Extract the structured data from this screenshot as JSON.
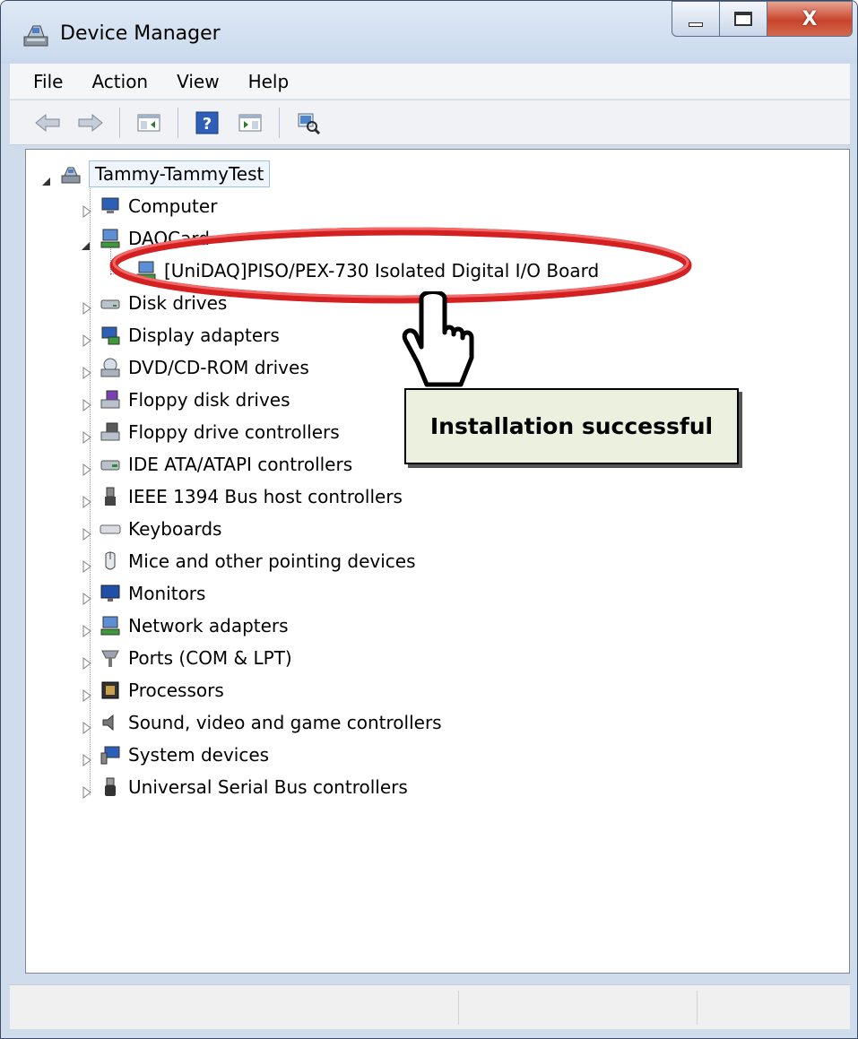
{
  "window": {
    "title": "Device Manager"
  },
  "menu": [
    "File",
    "Action",
    "View",
    "Help"
  ],
  "toolbar": {
    "icons": [
      "back-arrow-icon",
      "forward-arrow-icon",
      "show-hide-console-tree-icon",
      "help-icon",
      "properties-pane-icon",
      "scan-hardware-icon"
    ]
  },
  "tree": {
    "root": "Tammy-TammyTest",
    "categories": [
      {
        "label": "Computer",
        "icon": "computer-icon",
        "expanded": false
      },
      {
        "label": "DAQCard",
        "icon": "network-device-icon",
        "expanded": true,
        "children": [
          {
            "label": "[UniDAQ]PISO/PEX-730 Isolated Digital I/O Board",
            "icon": "network-device-icon"
          }
        ]
      },
      {
        "label": "Disk drives",
        "icon": "disk-drive-icon",
        "expanded": false
      },
      {
        "label": "Display adapters",
        "icon": "display-adapter-icon",
        "expanded": false
      },
      {
        "label": "DVD/CD-ROM drives",
        "icon": "dvd-drive-icon",
        "expanded": false
      },
      {
        "label": "Floppy disk drives",
        "icon": "floppy-drive-icon",
        "expanded": false
      },
      {
        "label": "Floppy drive controllers",
        "icon": "floppy-controller-icon",
        "expanded": false
      },
      {
        "label": "IDE ATA/ATAPI controllers",
        "icon": "ide-controller-icon",
        "expanded": false
      },
      {
        "label": "IEEE 1394 Bus host controllers",
        "icon": "ieee1394-icon",
        "expanded": false
      },
      {
        "label": "Keyboards",
        "icon": "keyboard-icon",
        "expanded": false
      },
      {
        "label": "Mice and other pointing devices",
        "icon": "mouse-icon",
        "expanded": false
      },
      {
        "label": "Monitors",
        "icon": "monitor-icon",
        "expanded": false
      },
      {
        "label": "Network adapters",
        "icon": "network-adapter-icon",
        "expanded": false
      },
      {
        "label": "Ports (COM & LPT)",
        "icon": "port-icon",
        "expanded": false
      },
      {
        "label": "Processors",
        "icon": "processor-icon",
        "expanded": false
      },
      {
        "label": "Sound, video and game controllers",
        "icon": "speaker-icon",
        "expanded": false
      },
      {
        "label": "System devices",
        "icon": "system-device-icon",
        "expanded": false
      },
      {
        "label": "Universal Serial Bus controllers",
        "icon": "usb-icon",
        "expanded": false
      }
    ]
  },
  "annotation": {
    "callout_text": "Installation successful",
    "highlight_color": "#d42020"
  }
}
